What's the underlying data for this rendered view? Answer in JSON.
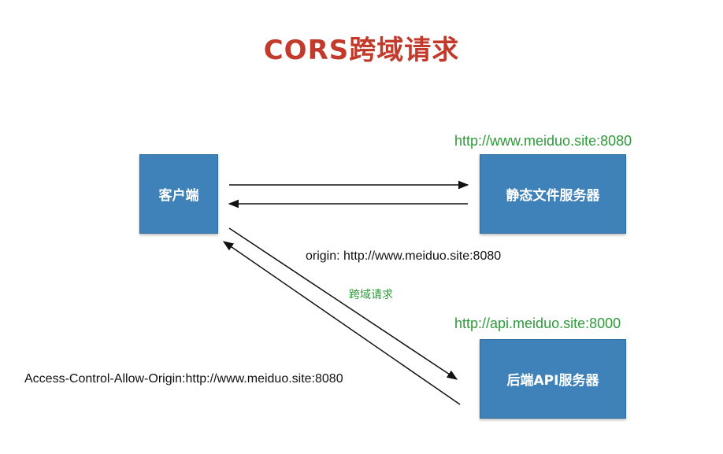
{
  "title": "CORS跨域请求",
  "nodes": {
    "client": "客户端",
    "static_server": "静态文件服务器",
    "api_server": "后端API服务器"
  },
  "urls": {
    "static_server": "http://www.meiduo.site:8080",
    "api_server": "http://api.meiduo.site:8000"
  },
  "edge_labels": {
    "origin_header": "origin: http://www.meiduo.site:8080",
    "cross_domain": "跨域请求",
    "allow_origin": "Access-Control-Allow-Origin:http://www.meiduo.site:8080"
  },
  "colors": {
    "title": "#c23a2b",
    "box": "#3f82b9",
    "url": "#2e9a3a"
  }
}
